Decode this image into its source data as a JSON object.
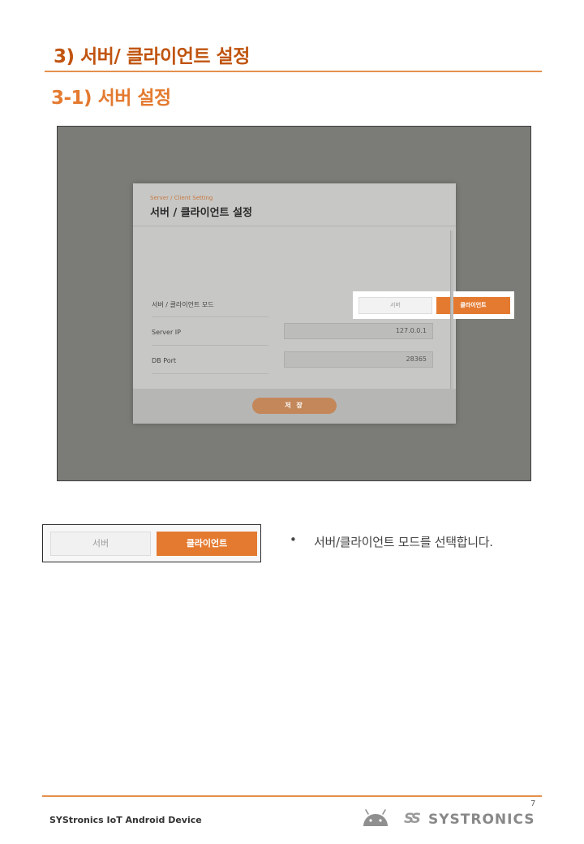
{
  "section_title": "3) 서버/ 클라이언트 설정",
  "sub_title": "3-1) 서버 설정",
  "screenshot": {
    "dialog": {
      "eyebrow": "Server / Client Setting",
      "title": "서버 / 클라이언트 설정",
      "rows": [
        {
          "label": "서버 / 클라이언트 모드",
          "server_label": "서버",
          "client_label": "클라이언트",
          "selected": "클라이언트"
        },
        {
          "label": "Server IP",
          "value": "127.0.0.1"
        },
        {
          "label": "DB Port",
          "value": "28365"
        }
      ],
      "save_label": "저 장"
    }
  },
  "zoom": {
    "server_label": "서버",
    "client_label": "클라이언트"
  },
  "bullet": {
    "symbol": "•",
    "text": "서버/클라이언트 모드를 선택합니다."
  },
  "footer": {
    "left_text": "SYStronics IoT Android Device",
    "page_number": "7",
    "brand_mark": "SS",
    "brand_name": "SYSTRONICS",
    "icons": [
      "android-icon",
      "systronics-logo-icon"
    ],
    "accent_color": "#e47a30"
  }
}
